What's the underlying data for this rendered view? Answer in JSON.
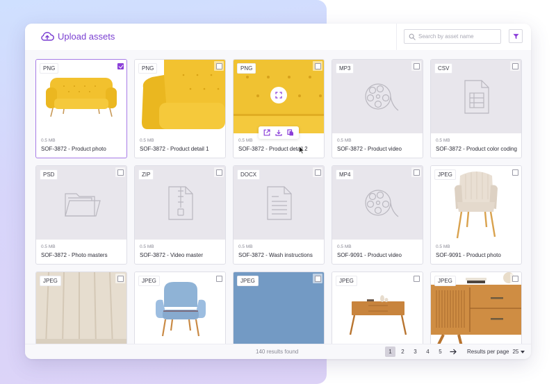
{
  "header": {
    "upload_label": "Upload assets",
    "search_placeholder": "Search by asset name",
    "search_value": ""
  },
  "colors": {
    "accent": "#7a3fd1",
    "checkbox_checked": "#8b3fd9",
    "placeholder_bg": "#e8e6ec"
  },
  "assets": [
    {
      "type": "PNG",
      "size": "0.5 MB",
      "name": "SOF-3872 - Product photo",
      "selected": true,
      "thumbnail": "yellow-sofa-photo"
    },
    {
      "type": "PNG",
      "size": "0.5 MB",
      "name": "SOF-3872 - Product detail 1",
      "selected": false,
      "thumbnail": "yellow-sofa-armrest-detail"
    },
    {
      "type": "PNG",
      "size": "0.5 MB",
      "name": "SOF-3872 - Product detail 2",
      "selected": false,
      "thumbnail": "yellow-sofa-tufting-detail",
      "hovered": true
    },
    {
      "type": "MP3",
      "size": "0.5 MB",
      "name": "SOF-3872 - Product video",
      "selected": false,
      "thumbnail": "film-reel-icon"
    },
    {
      "type": "CSV",
      "size": "0.5 MB",
      "name": "SOF-3872 - Product color coding",
      "selected": false,
      "thumbnail": "spreadsheet-file-icon"
    },
    {
      "type": "PSD",
      "size": "0.5 MB",
      "name": "SOF-3872 - Photo masters",
      "selected": false,
      "thumbnail": "folder-icon"
    },
    {
      "type": "ZIP",
      "size": "0.5 MB",
      "name": "SOF-3872 - Video master",
      "selected": false,
      "thumbnail": "zip-file-icon"
    },
    {
      "type": "DOCX",
      "size": "0.5 MB",
      "name": "SOF-3872 - Wash instructions",
      "selected": false,
      "thumbnail": "document-file-icon"
    },
    {
      "type": "MP4",
      "size": "0.5 MB",
      "name": "SOF-9091 - Product video",
      "selected": false,
      "thumbnail": "film-reel-icon"
    },
    {
      "type": "JPEG",
      "size": "0.5 MB",
      "name": "SOF-9091 - Product photo",
      "selected": false,
      "thumbnail": "beige-armchair-photo"
    },
    {
      "type": "JPEG",
      "selected": false,
      "thumbnail": "beige-fabric-closeup"
    },
    {
      "type": "JPEG",
      "selected": false,
      "thumbnail": "blue-armchair-photo"
    },
    {
      "type": "JPEG",
      "selected": false,
      "thumbnail": "blue-fabric-texture"
    },
    {
      "type": "JPEG",
      "selected": false,
      "thumbnail": "wooden-sideboard-photo"
    },
    {
      "type": "JPEG",
      "selected": false,
      "thumbnail": "wooden-sideboard-detail"
    }
  ],
  "hover_actions": {
    "expand": "expand-icon",
    "open": "open-external-icon",
    "download": "download-icon",
    "copy": "copy-icon"
  },
  "footer": {
    "results_text": "140 results found",
    "pages": [
      "1",
      "2",
      "3",
      "4",
      "5"
    ],
    "current_page": "1",
    "results_per_page_label": "Results per page",
    "results_per_page_value": "25"
  }
}
